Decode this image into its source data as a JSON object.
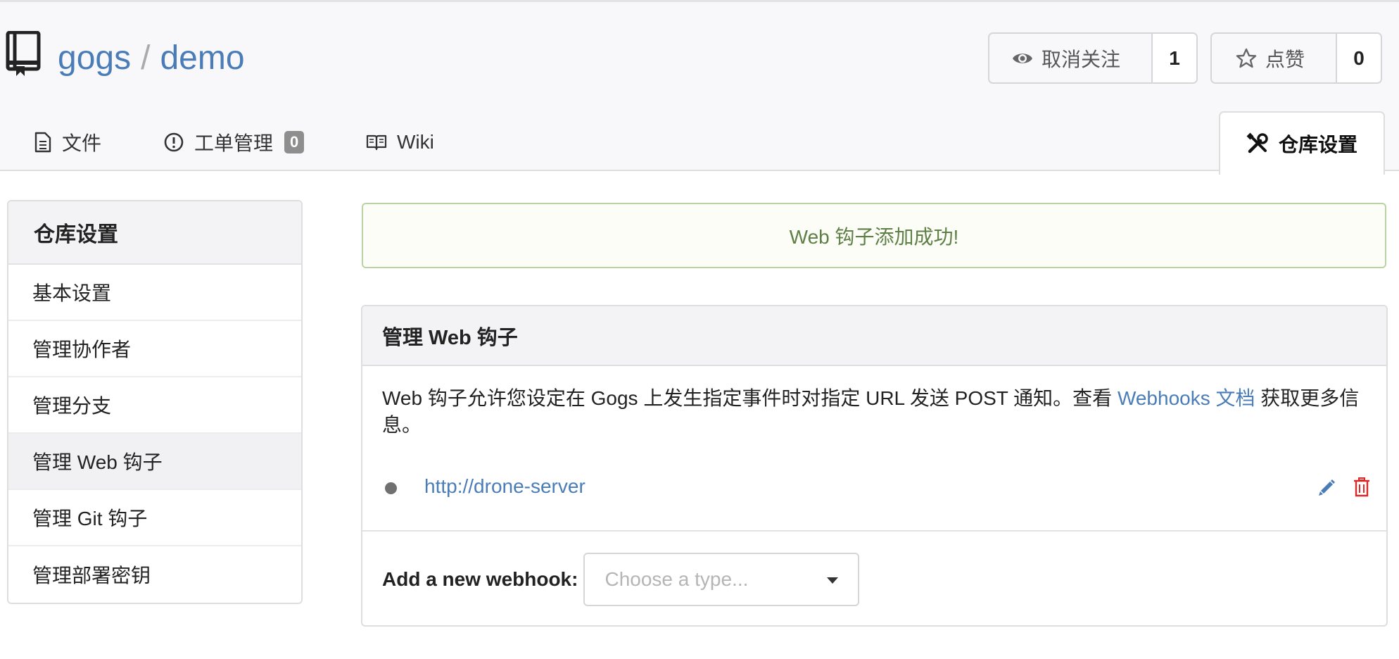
{
  "header": {
    "owner": "gogs",
    "separator": "/",
    "repo": "demo",
    "watch": {
      "label": "取消关注",
      "count": "1"
    },
    "star": {
      "label": "点赞",
      "count": "0"
    }
  },
  "tabs": {
    "files": "文件",
    "issues": "工单管理",
    "issues_count": "0",
    "wiki": "Wiki",
    "settings": "仓库设置"
  },
  "sidebar": {
    "title": "仓库设置",
    "items": [
      {
        "label": "基本设置"
      },
      {
        "label": "管理协作者"
      },
      {
        "label": "管理分支"
      },
      {
        "label": "管理 Web 钩子"
      },
      {
        "label": "管理 Git 钩子"
      },
      {
        "label": "管理部署密钥"
      }
    ],
    "active_index": 3
  },
  "alert": {
    "message": "Web 钩子添加成功!"
  },
  "webhooks": {
    "title": "管理 Web 钩子",
    "desc_before": "Web 钩子允许您设定在 Gogs 上发生指定事件时对指定 URL 发送 POST 通知。查看 ",
    "desc_link": "Webhooks 文档",
    "desc_after": " 获取更多信息。",
    "hooks": [
      {
        "url": "http://drone-server",
        "status": "unknown"
      }
    ],
    "add_label": "Add a new webhook:",
    "type_placeholder": "Choose a type..."
  },
  "colors": {
    "link": "#4a7db8",
    "success_text": "#5e7f45",
    "success_border": "#b9d3a5",
    "danger": "#db2828"
  }
}
